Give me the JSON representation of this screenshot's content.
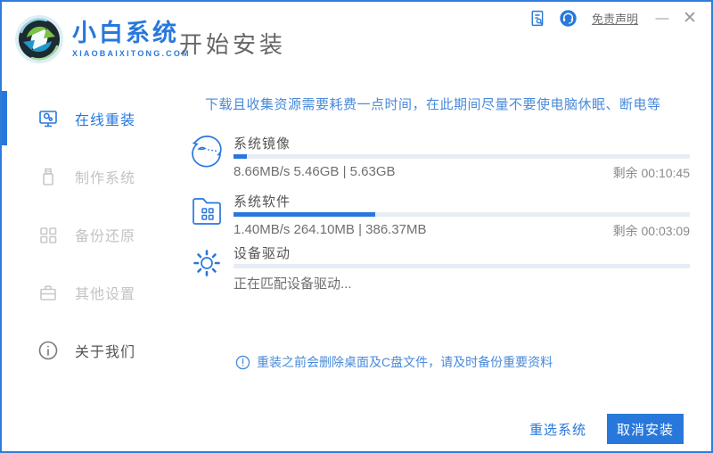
{
  "window": {
    "logo_title": "小白系统",
    "logo_sub": "XIAOBAIXITONG.COM",
    "page_title": "开始安装",
    "disclaimer_link": "免责声明",
    "minimize_glyph": "—",
    "close_glyph": "✕"
  },
  "colors": {
    "accent_blue": "#2878dc",
    "notice_blue": "#4a8ada",
    "border_blue": "#2e7cdb",
    "track_gray": "#e7edf5",
    "disabled_gray": "#c3c3c3"
  },
  "sidebar": {
    "items": [
      {
        "label": "在线重装",
        "state": "active"
      },
      {
        "label": "制作系统",
        "state": "disabled"
      },
      {
        "label": "备份还原",
        "state": "disabled"
      },
      {
        "label": "其他设置",
        "state": "disabled"
      },
      {
        "label": "关于我们",
        "state": "normal"
      }
    ]
  },
  "main": {
    "notice": "下载且收集资源需要耗费一点时间，在此期间尽量不要使电脑休眠、断电等",
    "tasks": [
      {
        "label": "系统镜像",
        "detail": "8.66MB/s 5.46GB | 5.63GB",
        "remaining": "剩余 00:10:45",
        "percent": 3
      },
      {
        "label": "系统软件",
        "detail": "1.40MB/s 264.10MB | 386.37MB",
        "remaining": "剩余 00:03:09",
        "percent": 31
      },
      {
        "label": "设备驱动",
        "detail": "正在匹配设备驱动...",
        "remaining": "",
        "percent": 0
      }
    ],
    "note": "重装之前会删除桌面及C盘文件，请及时备份重要资料"
  },
  "footer": {
    "reselect_label": "重选系统",
    "cancel_label": "取消安装"
  }
}
